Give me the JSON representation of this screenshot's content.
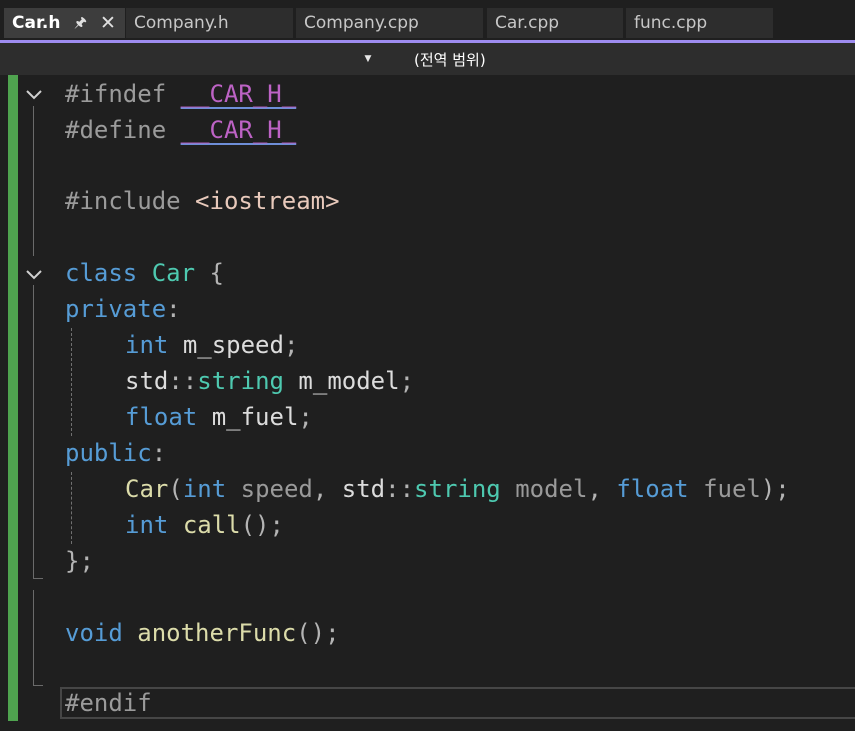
{
  "tabs": [
    {
      "label": "Car.h",
      "active": true,
      "pin_icon": "pin-icon",
      "close_icon": "close-icon"
    },
    {
      "label": "Company.h",
      "active": false
    },
    {
      "label": "Company.cpp",
      "active": false
    },
    {
      "label": "Car.cpp",
      "active": false
    },
    {
      "label": "func.cpp",
      "active": false
    }
  ],
  "nav": {
    "scope": "(전역 범위)"
  },
  "code": {
    "line1": [
      "#ifndef",
      " ",
      "__CAR_H_"
    ],
    "line2": [
      "#define",
      " ",
      "__CAR_H_"
    ],
    "line3": [
      "#include",
      " ",
      "<iostream>"
    ],
    "line4": [
      "class",
      " ",
      "Car",
      " ",
      "{"
    ],
    "line5": [
      "private",
      ":"
    ],
    "line6": [
      "int",
      " ",
      "m_speed",
      ";"
    ],
    "line7": [
      "std",
      "::",
      "string",
      " ",
      "m_model",
      ";"
    ],
    "line8": [
      "float",
      " ",
      "m_fuel",
      ";"
    ],
    "line9": [
      "public",
      ":"
    ],
    "line10": [
      "Car",
      "(",
      "int",
      " ",
      "speed",
      ", ",
      "std",
      "::",
      "string",
      " ",
      "model",
      ", ",
      "float",
      " ",
      "fuel",
      ");"
    ],
    "line11": [
      "int",
      " ",
      "call",
      "();"
    ],
    "line12": [
      "};"
    ],
    "line13": [
      "void",
      " ",
      "anotherFunc",
      "();"
    ],
    "line14": [
      "#endif"
    ]
  },
  "colors": {
    "accent": "#9e8cf0",
    "change_bar": "#4fa34f",
    "keyword": "#569cd6",
    "type": "#4ec9b0",
    "function": "#dcdcaa",
    "macro": "#bd63c5",
    "include_string": "#e8c9bb"
  }
}
